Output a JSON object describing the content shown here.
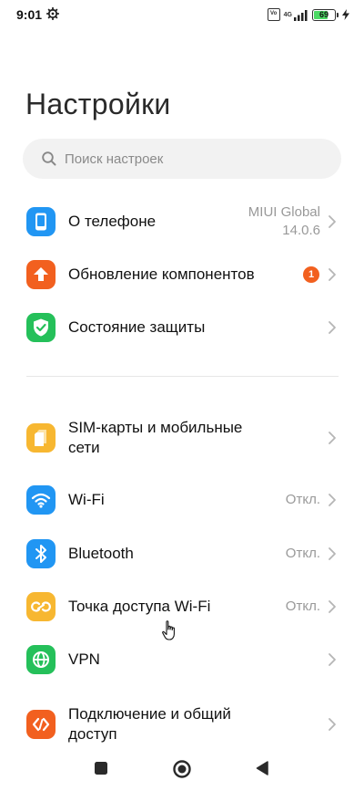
{
  "status_bar": {
    "time": "9:01",
    "network": "4G",
    "battery": "69",
    "battery_level_percent": 69
  },
  "title": "Настройки",
  "search": {
    "placeholder": "Поиск настроек"
  },
  "section1": [
    {
      "label": "О телефоне",
      "value_line1": "MIUI Global",
      "value_line2": "14.0.6",
      "icon": "phone-icon",
      "color": "#2196f3"
    },
    {
      "label": "Обновление компонентов",
      "badge": "1",
      "icon": "update-arrow-icon",
      "color": "#f2601f"
    },
    {
      "label": "Состояние защиты",
      "icon": "shield-check-icon",
      "color": "#25c05a"
    }
  ],
  "section2": [
    {
      "label_line1": "SIM-карты и мобильные",
      "label_line2": "сети",
      "icon": "sim-card-icon",
      "color": "#f7b731"
    },
    {
      "label": "Wi-Fi",
      "value": "Откл.",
      "icon": "wifi-icon",
      "color": "#2196f3"
    },
    {
      "label": "Bluetooth",
      "value": "Откл.",
      "icon": "bluetooth-icon",
      "color": "#2196f3"
    },
    {
      "label": "Точка доступа Wi-Fi",
      "value": "Откл.",
      "icon": "hotspot-icon",
      "color": "#f7b731"
    },
    {
      "label": "VPN",
      "icon": "globe-icon",
      "color": "#25c05a"
    },
    {
      "label_line1": "Подключение и общий",
      "label_line2": "доступ",
      "icon": "connection-sharing-icon",
      "color": "#f2601f"
    }
  ],
  "nav": [
    "recents-icon",
    "home-icon",
    "back-icon"
  ]
}
